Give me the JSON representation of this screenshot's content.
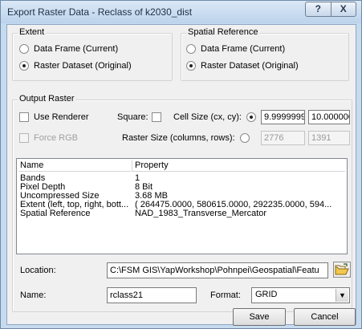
{
  "window": {
    "title": "Export Raster Data - Reclass of k2030_dist",
    "help_label": "?",
    "close_label": "X"
  },
  "extent": {
    "legend": "Extent",
    "options": [
      {
        "label": "Data Frame (Current)",
        "selected": false
      },
      {
        "label": "Raster Dataset (Original)",
        "selected": true
      }
    ]
  },
  "spatial_reference": {
    "legend": "Spatial Reference",
    "options": [
      {
        "label": "Data Frame (Current)",
        "selected": false
      },
      {
        "label": "Raster Dataset (Original)",
        "selected": true
      }
    ]
  },
  "output_raster": {
    "legend": "Output Raster",
    "use_renderer_label": "Use Renderer",
    "square_label": "Square:",
    "cell_size_label": "Cell Size (cx, cy):",
    "cell_size_x": "9.9999999",
    "cell_size_y": "10.000000",
    "force_rgb_label": "Force RGB",
    "raster_size_label": "Raster Size (columns, rows):",
    "raster_columns": "2776",
    "raster_rows": "1391"
  },
  "properties": {
    "headers": [
      "Name",
      "Property"
    ],
    "rows": [
      [
        "Bands",
        "1"
      ],
      [
        "Pixel Depth",
        "8 Bit"
      ],
      [
        "Uncompressed Size",
        "3.68 MB"
      ],
      [
        "Extent (left, top, right, bott...",
        "( 264475.0000, 580615.0000, 292235.0000, 594..."
      ],
      [
        "Spatial Reference",
        "NAD_1983_Transverse_Mercator"
      ]
    ]
  },
  "location": {
    "label": "Location:",
    "value": "C:\\FSM GIS\\YapWorkshop\\Pohnpei\\Geospatial\\Featu"
  },
  "name": {
    "label": "Name:",
    "value": "rclass21"
  },
  "format": {
    "label": "Format:",
    "value": "GRID"
  },
  "buttons": {
    "save": "Save",
    "cancel": "Cancel"
  }
}
